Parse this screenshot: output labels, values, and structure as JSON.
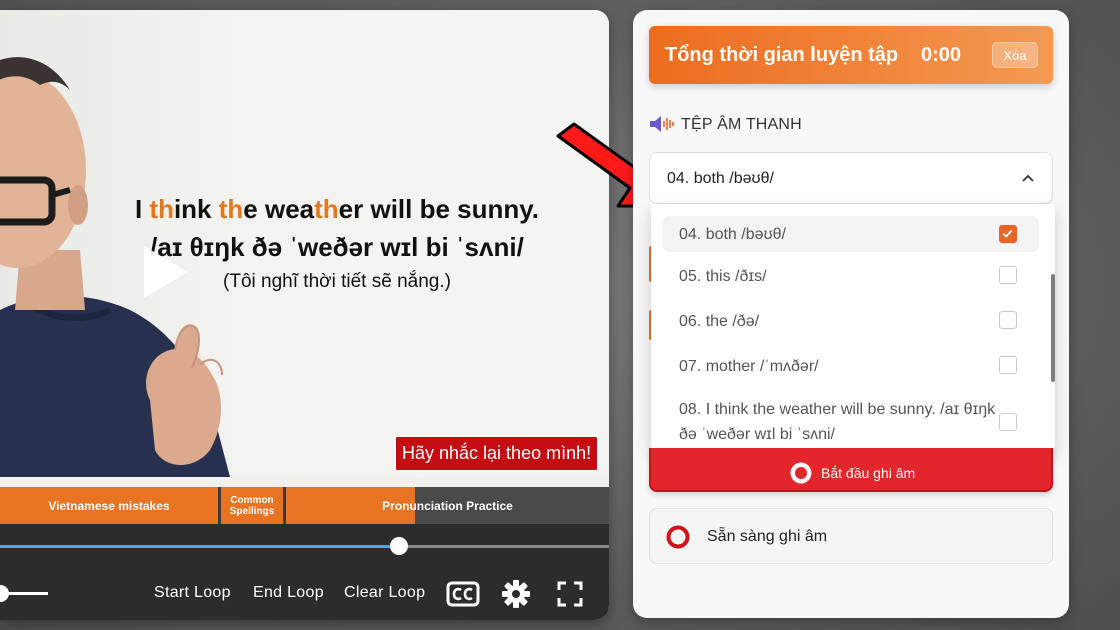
{
  "video": {
    "sentence_parts": [
      {
        "text": "I ",
        "hl": false
      },
      {
        "text": "th",
        "hl": true
      },
      {
        "text": "ink ",
        "hl": false
      },
      {
        "text": "th",
        "hl": true
      },
      {
        "text": "e wea",
        "hl": false
      },
      {
        "text": "th",
        "hl": true
      },
      {
        "text": "er will be sunny.",
        "hl": false
      }
    ],
    "ipa": "/aɪ θɪŋk ðə ˈweðər wɪl bi ˈsʌni/",
    "translation": "(Tôi nghĩ thời tiết sẽ nắng.)",
    "repeat_badge": "Hãy nhắc lại theo mình!",
    "chapters": [
      "Vietnamese mistakes",
      "Common Spellings",
      "Pronunciation Practice"
    ],
    "progress_fraction": 0.655,
    "volume_fraction": 0.0,
    "controls": {
      "start_loop": "Start Loop",
      "end_loop": "End Loop",
      "clear_loop": "Clear Loop"
    },
    "icons": [
      "play-icon",
      "cc-icon",
      "gear-icon",
      "fullscreen-icon"
    ]
  },
  "panel": {
    "practice_title": "Tổng thời gian luyện tập",
    "practice_time": "0:00",
    "clear_label": "Xóa",
    "audio_section_title": "TỆP ÂM THANH",
    "selected_value": "04. both /bəʊθ/",
    "options": [
      {
        "label": "04. both /bəʊθ/",
        "checked": true
      },
      {
        "label": "05. this /ðɪs/",
        "checked": false
      },
      {
        "label": "06. the /ðə/",
        "checked": false
      },
      {
        "label": "07. mother /ˈmʌðər/",
        "checked": false
      },
      {
        "label": "08. I think the weather will be sunny. /aɪ θɪŋk ðə ˈweðər wɪl bi ˈsʌni/",
        "checked": false
      }
    ],
    "record_label": "Bắt đầu ghi âm",
    "status_text": "Sẵn sàng ghi âm"
  },
  "colors": {
    "accent_orange": "#ec6c1f",
    "record_red": "#e3262c",
    "progress_blue": "#4ea8e8",
    "annotation_red": "#ff1a1a"
  }
}
